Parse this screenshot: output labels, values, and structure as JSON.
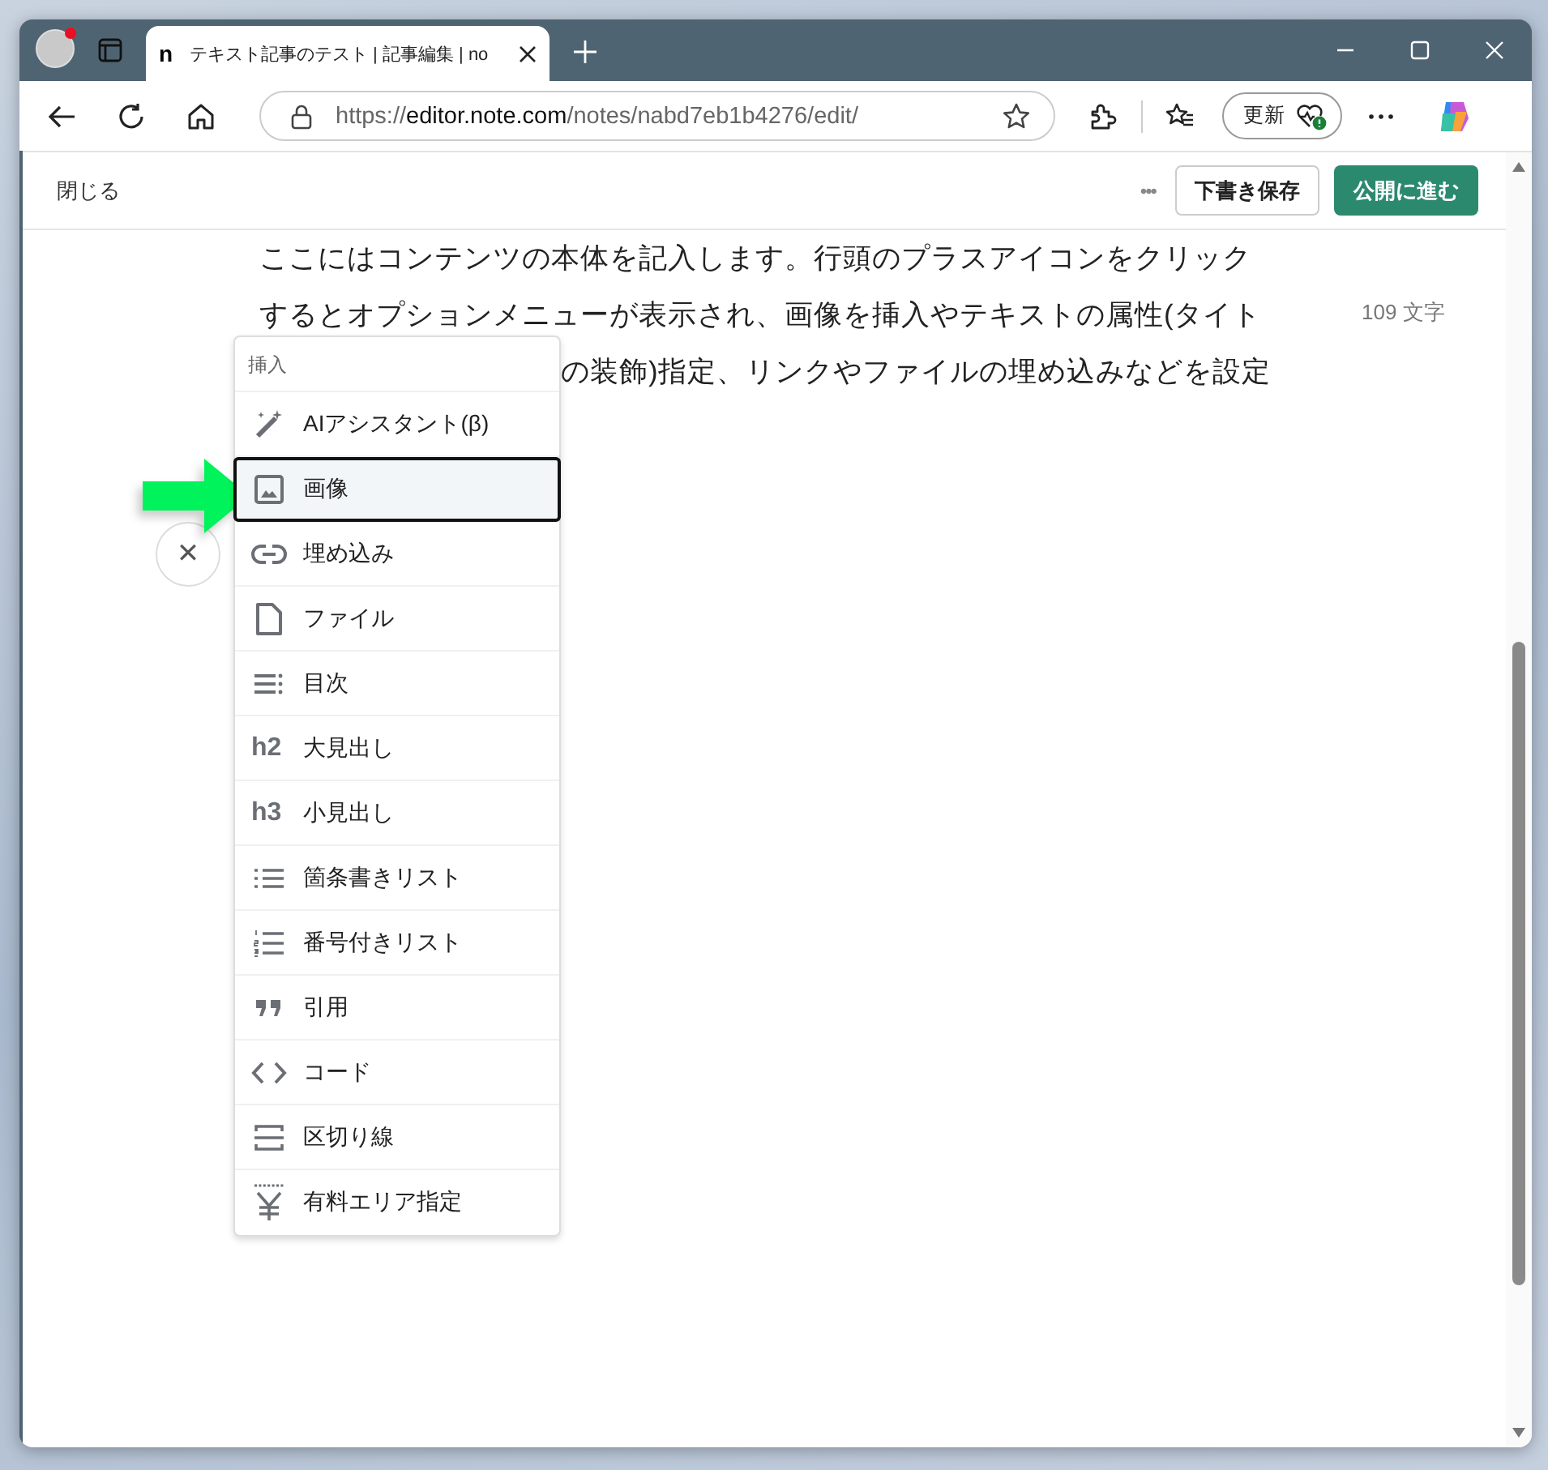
{
  "browser": {
    "tab": {
      "favicon": "n",
      "title": "テキスト記事のテスト | 記事編集 | no"
    },
    "address": {
      "scheme": "https://",
      "host": "editor.note.com",
      "path": "/notes/nabd7eb1b4276/edit/"
    },
    "update_button": "更新"
  },
  "editor_header": {
    "close": "閉じる",
    "more": "•••",
    "save_draft": "下書き保存",
    "publish": "公開に進む"
  },
  "body": {
    "lines": [
      "ここにはコンテンツの本体を記入します。行頭のプラスアイコンをクリック",
      "するとオプションメニューが表示され、画像を挿入やテキストの属性(タイト",
      "の装飾)指定、リンクやファイルの埋め込みなどを設定"
    ],
    "char_count": "109 文字"
  },
  "close_button": "✕",
  "insert_menu": {
    "title": "挿入",
    "items": [
      {
        "kind": "wand",
        "label": "AIアシスタント(β)",
        "selected": false
      },
      {
        "kind": "image",
        "label": "画像",
        "selected": true
      },
      {
        "kind": "link",
        "label": "埋め込み",
        "selected": false
      },
      {
        "kind": "file",
        "label": "ファイル",
        "selected": false
      },
      {
        "kind": "toc",
        "label": "目次",
        "selected": false
      },
      {
        "kind": "heading",
        "icon_text": "h2",
        "label": "大見出し",
        "selected": false
      },
      {
        "kind": "heading",
        "icon_text": "h3",
        "label": "小見出し",
        "selected": false
      },
      {
        "kind": "bullets",
        "label": "箇条書きリスト",
        "selected": false
      },
      {
        "kind": "numbers",
        "label": "番号付きリスト",
        "selected": false
      },
      {
        "kind": "quote",
        "label": "引用",
        "selected": false
      },
      {
        "kind": "code",
        "label": "コード",
        "selected": false
      },
      {
        "kind": "divider",
        "label": "区切り線",
        "selected": false
      },
      {
        "kind": "yen",
        "label": "有料エリア指定",
        "selected": false
      }
    ]
  }
}
